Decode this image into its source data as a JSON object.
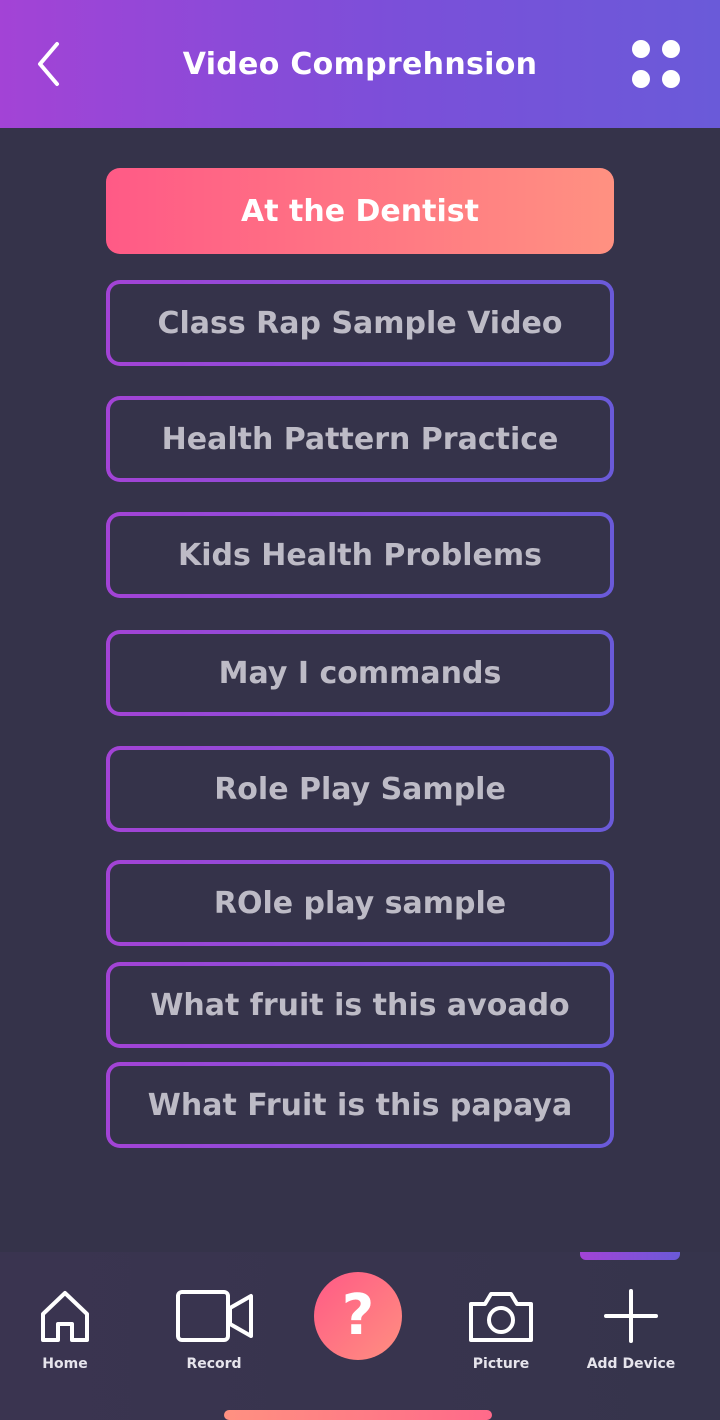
{
  "header": {
    "title": "Video Comprehnsion",
    "back_icon": "chevron-left-icon",
    "menu_icon": "grid-dots-icon",
    "gradient": [
      "#a343d6",
      "#6a5ad9"
    ]
  },
  "videos": {
    "items": [
      {
        "label": "At the Dentist",
        "selected": true
      },
      {
        "label": "Class Rap Sample Video",
        "selected": false
      },
      {
        "label": "Health Pattern Practice",
        "selected": false
      },
      {
        "label": "Kids Health Problems",
        "selected": false
      },
      {
        "label": "May I commands",
        "selected": false
      },
      {
        "label": "Role Play Sample",
        "selected": false
      },
      {
        "label": "ROle play sample",
        "selected": false
      },
      {
        "label": "What fruit is this avoado",
        "selected": false
      },
      {
        "label": "What Fruit is this papaya",
        "selected": false
      }
    ],
    "selected_color": [
      "#ff5a86",
      "#ff9181"
    ]
  },
  "tabbar": {
    "tabs": [
      {
        "label": "Home",
        "icon": "home-icon"
      },
      {
        "label": "Record",
        "icon": "video-camera-icon"
      },
      {
        "label": "?",
        "icon": "help-icon"
      },
      {
        "label": "Picture",
        "icon": "camera-icon"
      },
      {
        "label": "Add Device",
        "icon": "plus-icon"
      }
    ],
    "active_tab": "Add Device"
  }
}
